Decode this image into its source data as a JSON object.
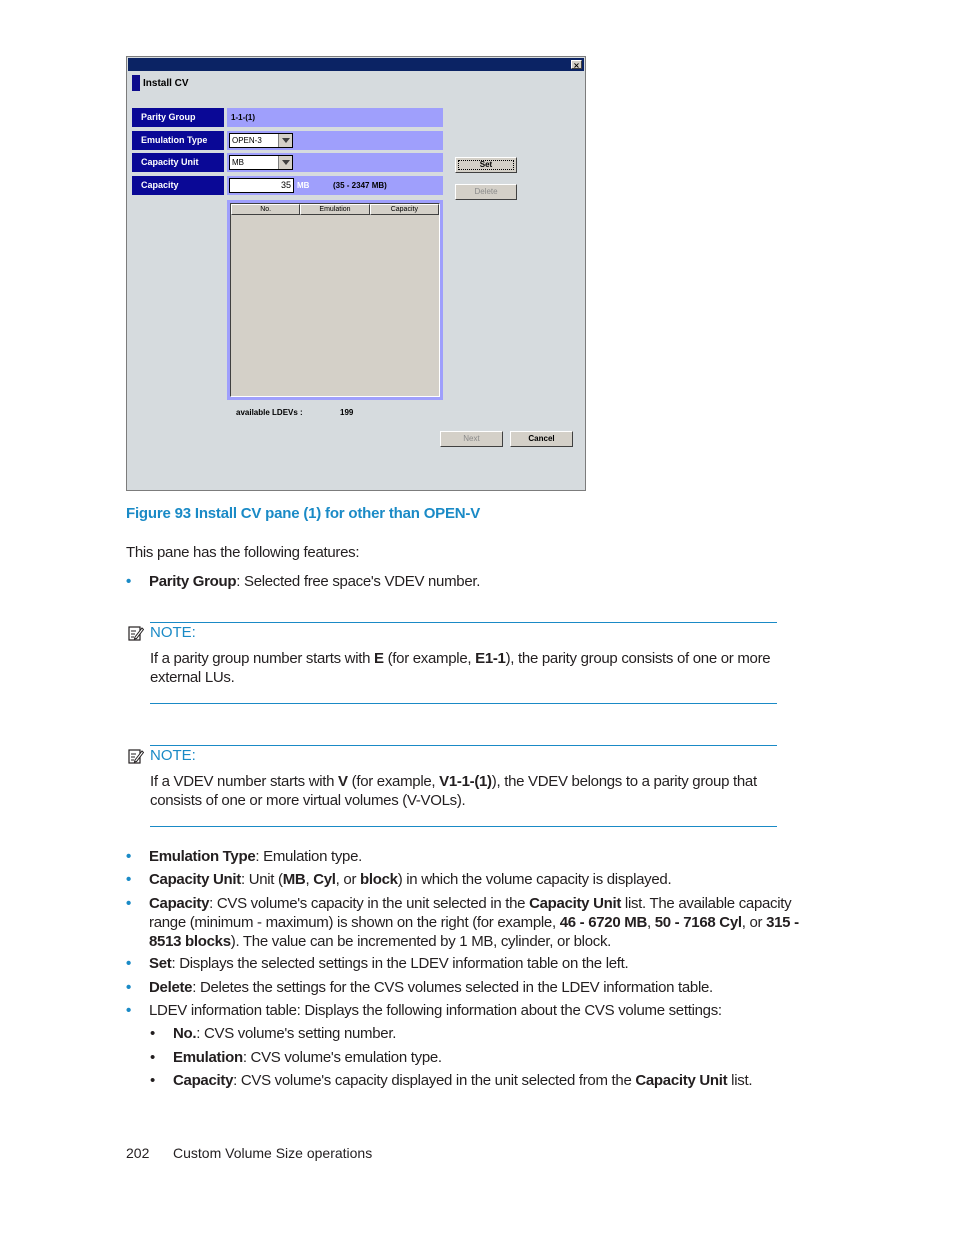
{
  "dialog": {
    "close_label": "×",
    "pane_title": "Install CV",
    "fields": {
      "parity_group": {
        "label": "Parity Group",
        "value": "1-1-(1)"
      },
      "emulation_type": {
        "label": "Emulation Type",
        "value": "OPEN-3"
      },
      "capacity_unit": {
        "label": "Capacity Unit",
        "value": "MB"
      },
      "capacity": {
        "label": "Capacity",
        "value": "35",
        "unit": "MB",
        "range": "(35 - 2347 MB)"
      }
    },
    "buttons": {
      "set": "Set",
      "delete": "Delete",
      "next": "Next",
      "cancel": "Cancel"
    },
    "table": {
      "columns": [
        "No.",
        "Emulation",
        "Capacity"
      ],
      "rows": []
    },
    "available_ldevs": {
      "label": "available LDEVs :",
      "value": "199"
    }
  },
  "caption": "Figure 93 Install CV pane (1) for other than OPEN-V",
  "intro": "This pane has the following features:",
  "bullets": {
    "parity_group": {
      "term": "Parity Group",
      "text": ": Selected free space's VDEV number."
    },
    "emulation_type": {
      "term": "Emulation Type",
      "text": ": Emulation type."
    },
    "capacity_unit": {
      "term": "Capacity Unit",
      "t1": ": Unit (",
      "b1": "MB",
      "t2": ", ",
      "b2": "Cyl",
      "t3": ", or ",
      "b3": "block",
      "t4": ") in which the volume capacity is displayed."
    },
    "capacity": {
      "term": "Capacity",
      "t1": ": CVS volume's capacity in the unit selected in the ",
      "b1": "Capacity Unit",
      "t2": " list. The available capacity range (minimum - maximum) is shown on the right (for example, ",
      "b2": "46 - 6720 MB",
      "t3": ", ",
      "b3": "50 - 7168 Cyl",
      "t4": ", or ",
      "b4": "315 - 8513 blocks",
      "t5": "). The value can be incremented by 1 MB, cylinder, or block."
    },
    "set": {
      "term": "Set",
      "text": ": Displays the selected settings in the LDEV information table on the left."
    },
    "delete": {
      "term": "Delete",
      "text": ": Deletes the settings for the CVS volumes selected in the LDEV information table."
    },
    "ldev_table": {
      "text": "LDEV information table: Displays the following information about the CVS volume settings:"
    },
    "sub": {
      "no": {
        "term": "No.",
        "text": ": CVS volume's setting number."
      },
      "emulation": {
        "term": "Emulation",
        "text": ": CVS volume's emulation type."
      },
      "capacity": {
        "term": "Capacity",
        "t1": ": CVS volume's capacity displayed in the unit selected from the ",
        "b1": "Capacity Unit",
        "t2": " list."
      }
    }
  },
  "notes": [
    {
      "label": "NOTE:",
      "t1": "If a parity group number starts with ",
      "b1": "E",
      "t2": " (for example, ",
      "b2": "E1-1",
      "t3": "), the parity group consists of one or more external LUs."
    },
    {
      "label": "NOTE:",
      "t1": "If a VDEV number starts with ",
      "b1": "V",
      "t2": " (for example, ",
      "b2": "V1-1-(1)",
      "t3": "), the VDEV belongs to a parity group that consists of one or more virtual volumes (V-VOLs)."
    }
  ],
  "bullet_glyph": "•",
  "footer": {
    "page_number": "202",
    "section": "Custom Volume Size operations"
  },
  "colors": {
    "accent": "#1a8ac6",
    "dialog_label_bg": "#0a0896",
    "dialog_value_bg": "#9f9ffc",
    "titlebar": "#0b2364"
  }
}
